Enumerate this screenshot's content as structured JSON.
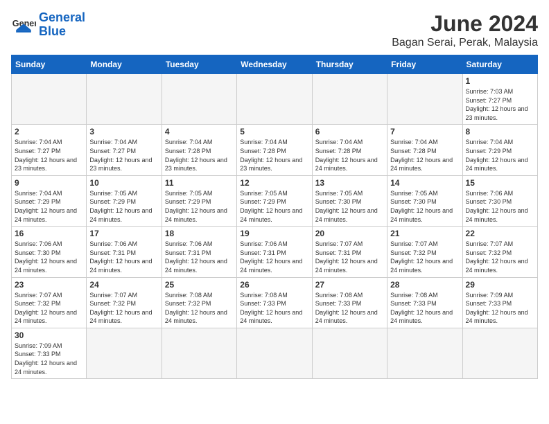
{
  "header": {
    "logo_general": "General",
    "logo_blue": "Blue",
    "title": "June 2024",
    "subtitle": "Bagan Serai, Perak, Malaysia"
  },
  "weekdays": [
    "Sunday",
    "Monday",
    "Tuesday",
    "Wednesday",
    "Thursday",
    "Friday",
    "Saturday"
  ],
  "days": {
    "1": {
      "sunrise": "7:03 AM",
      "sunset": "7:27 PM",
      "daylight": "12 hours and 23 minutes."
    },
    "2": {
      "sunrise": "7:04 AM",
      "sunset": "7:27 PM",
      "daylight": "12 hours and 23 minutes."
    },
    "3": {
      "sunrise": "7:04 AM",
      "sunset": "7:27 PM",
      "daylight": "12 hours and 23 minutes."
    },
    "4": {
      "sunrise": "7:04 AM",
      "sunset": "7:28 PM",
      "daylight": "12 hours and 23 minutes."
    },
    "5": {
      "sunrise": "7:04 AM",
      "sunset": "7:28 PM",
      "daylight": "12 hours and 23 minutes."
    },
    "6": {
      "sunrise": "7:04 AM",
      "sunset": "7:28 PM",
      "daylight": "12 hours and 24 minutes."
    },
    "7": {
      "sunrise": "7:04 AM",
      "sunset": "7:28 PM",
      "daylight": "12 hours and 24 minutes."
    },
    "8": {
      "sunrise": "7:04 AM",
      "sunset": "7:29 PM",
      "daylight": "12 hours and 24 minutes."
    },
    "9": {
      "sunrise": "7:04 AM",
      "sunset": "7:29 PM",
      "daylight": "12 hours and 24 minutes."
    },
    "10": {
      "sunrise": "7:05 AM",
      "sunset": "7:29 PM",
      "daylight": "12 hours and 24 minutes."
    },
    "11": {
      "sunrise": "7:05 AM",
      "sunset": "7:29 PM",
      "daylight": "12 hours and 24 minutes."
    },
    "12": {
      "sunrise": "7:05 AM",
      "sunset": "7:29 PM",
      "daylight": "12 hours and 24 minutes."
    },
    "13": {
      "sunrise": "7:05 AM",
      "sunset": "7:30 PM",
      "daylight": "12 hours and 24 minutes."
    },
    "14": {
      "sunrise": "7:05 AM",
      "sunset": "7:30 PM",
      "daylight": "12 hours and 24 minutes."
    },
    "15": {
      "sunrise": "7:06 AM",
      "sunset": "7:30 PM",
      "daylight": "12 hours and 24 minutes."
    },
    "16": {
      "sunrise": "7:06 AM",
      "sunset": "7:30 PM",
      "daylight": "12 hours and 24 minutes."
    },
    "17": {
      "sunrise": "7:06 AM",
      "sunset": "7:31 PM",
      "daylight": "12 hours and 24 minutes."
    },
    "18": {
      "sunrise": "7:06 AM",
      "sunset": "7:31 PM",
      "daylight": "12 hours and 24 minutes."
    },
    "19": {
      "sunrise": "7:06 AM",
      "sunset": "7:31 PM",
      "daylight": "12 hours and 24 minutes."
    },
    "20": {
      "sunrise": "7:07 AM",
      "sunset": "7:31 PM",
      "daylight": "12 hours and 24 minutes."
    },
    "21": {
      "sunrise": "7:07 AM",
      "sunset": "7:32 PM",
      "daylight": "12 hours and 24 minutes."
    },
    "22": {
      "sunrise": "7:07 AM",
      "sunset": "7:32 PM",
      "daylight": "12 hours and 24 minutes."
    },
    "23": {
      "sunrise": "7:07 AM",
      "sunset": "7:32 PM",
      "daylight": "12 hours and 24 minutes."
    },
    "24": {
      "sunrise": "7:07 AM",
      "sunset": "7:32 PM",
      "daylight": "12 hours and 24 minutes."
    },
    "25": {
      "sunrise": "7:08 AM",
      "sunset": "7:32 PM",
      "daylight": "12 hours and 24 minutes."
    },
    "26": {
      "sunrise": "7:08 AM",
      "sunset": "7:33 PM",
      "daylight": "12 hours and 24 minutes."
    },
    "27": {
      "sunrise": "7:08 AM",
      "sunset": "7:33 PM",
      "daylight": "12 hours and 24 minutes."
    },
    "28": {
      "sunrise": "7:08 AM",
      "sunset": "7:33 PM",
      "daylight": "12 hours and 24 minutes."
    },
    "29": {
      "sunrise": "7:09 AM",
      "sunset": "7:33 PM",
      "daylight": "12 hours and 24 minutes."
    },
    "30": {
      "sunrise": "7:09 AM",
      "sunset": "7:33 PM",
      "daylight": "12 hours and 24 minutes."
    }
  }
}
